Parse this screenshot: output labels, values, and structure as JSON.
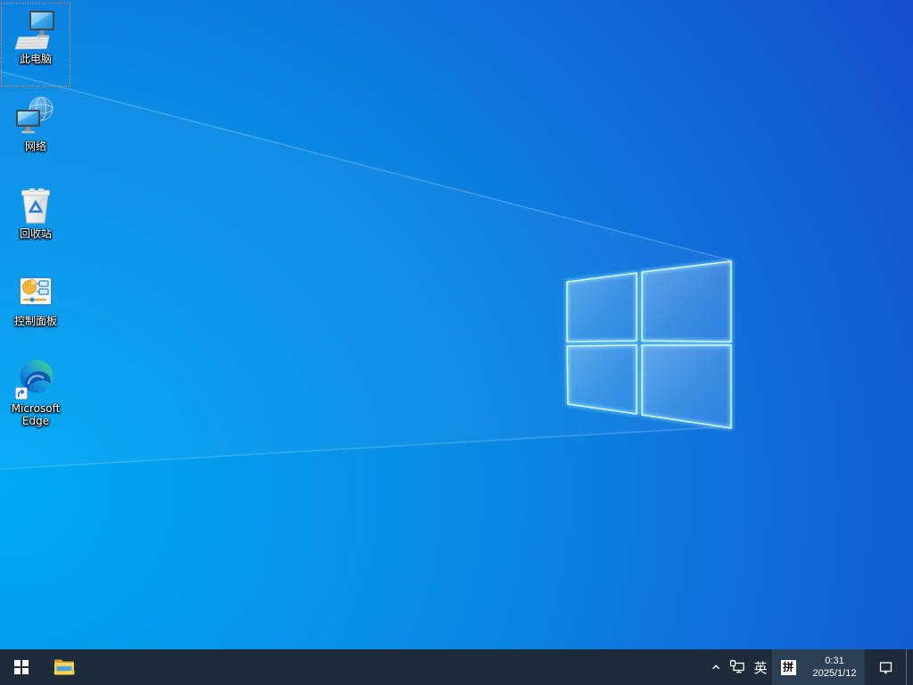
{
  "desktop": {
    "icons": [
      {
        "label": "此电脑",
        "selected": true
      },
      {
        "label": "网络",
        "selected": false
      },
      {
        "label": "回收站",
        "selected": false
      },
      {
        "label": "控制面板",
        "selected": false
      },
      {
        "label": "Microsoft Edge",
        "selected": false
      }
    ]
  },
  "taskbar": {
    "tray": {
      "language": "英",
      "ime_mode": "拼",
      "time": "0:31",
      "date": "2025/1/12"
    }
  },
  "colors": {
    "taskbar_bg": "#1d2b3a",
    "tray_highlight": "#2d3f54",
    "wallpaper_bright": "#00aaf5",
    "wallpaper_mid": "#0a8ae4",
    "wallpaper_deep": "#1747cd",
    "focus_rect": "#e8833a",
    "folder_yellow": "#fbd34b",
    "edge_blue": "#0d57b8",
    "edge_green": "#45dd8b"
  }
}
